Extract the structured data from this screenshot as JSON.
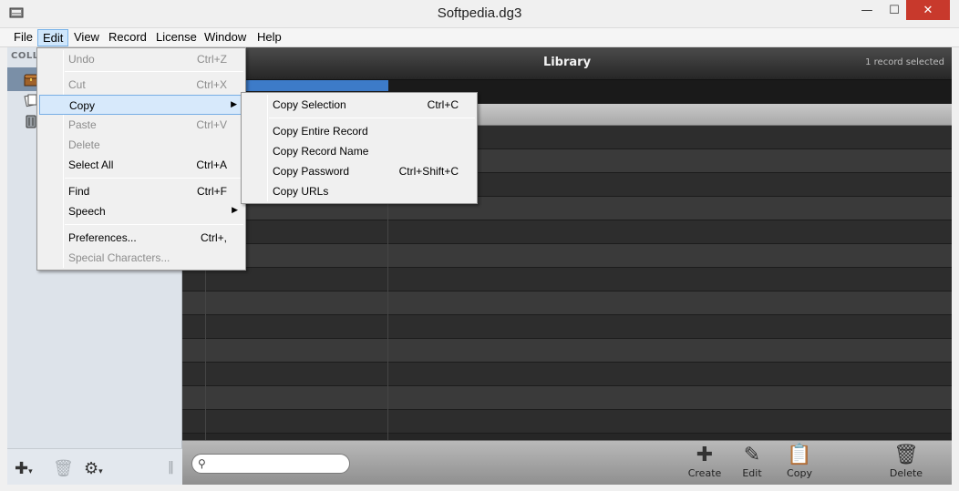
{
  "window": {
    "title": "Softpedia.dg3",
    "minimize": "—",
    "maximize": "☐",
    "close": "✕"
  },
  "menubar": [
    "File",
    "Edit",
    "View",
    "Record",
    "License",
    "Window",
    "Help"
  ],
  "sidebar": {
    "header": "COLL",
    "footer_icons": [
      "add-icon",
      "trash-icon",
      "gear-icon"
    ]
  },
  "library": {
    "title": "Library",
    "selection_status": "1 record selected"
  },
  "edit_menu": {
    "items": [
      {
        "label": "Undo",
        "shortcut": "Ctrl+Z"
      },
      {
        "label": "Cut",
        "shortcut": "Ctrl+X"
      },
      {
        "label": "Copy",
        "shortcut": ""
      },
      {
        "label": "Paste",
        "shortcut": "Ctrl+V"
      },
      {
        "label": "Delete",
        "shortcut": ""
      },
      {
        "label": "Select All",
        "shortcut": "Ctrl+A"
      },
      {
        "label": "Find",
        "shortcut": "Ctrl+F"
      },
      {
        "label": "Speech",
        "shortcut": ""
      },
      {
        "label": "Preferences...",
        "shortcut": "Ctrl+,"
      },
      {
        "label": "Special Characters...",
        "shortcut": ""
      }
    ]
  },
  "copy_submenu": {
    "items": [
      {
        "label": "Copy Selection",
        "shortcut": "Ctrl+C"
      },
      {
        "label": "Copy Entire Record",
        "shortcut": ""
      },
      {
        "label": "Copy Record Name",
        "shortcut": ""
      },
      {
        "label": "Copy Password",
        "shortcut": "Ctrl+Shift+C"
      },
      {
        "label": "Copy URLs",
        "shortcut": ""
      }
    ]
  },
  "toolbar": {
    "search_placeholder": "",
    "create_label": "Create",
    "edit_label": "Edit",
    "copy_label": "Copy",
    "delete_label": "Delete"
  },
  "colors": {
    "header_dark": "#262626",
    "menu_highlight": "#d7e9fb",
    "sidebar_bg": "#dde3ea",
    "close_red": "#c8392c"
  }
}
